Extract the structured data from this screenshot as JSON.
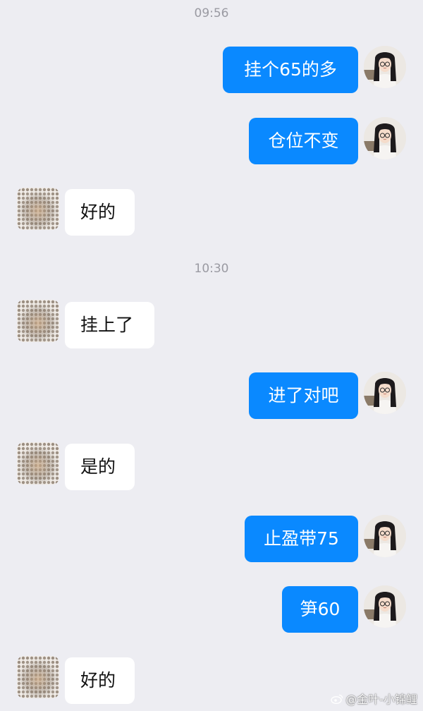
{
  "colors": {
    "background": "#ededf2",
    "outgoing_bubble": "#0a89ff",
    "incoming_bubble": "#ffffff",
    "timestamp": "#9a9aa2"
  },
  "timestamps": [
    "09:56",
    "10:30"
  ],
  "messages": [
    {
      "sender": "me",
      "text": "挂个65的多",
      "avatar_icon": "avatar-girl-glasses-icon"
    },
    {
      "sender": "me",
      "text": "仓位不变",
      "avatar_icon": "avatar-girl-glasses-icon"
    },
    {
      "sender": "them",
      "text": "好的",
      "avatar_icon": "avatar-blurred-icon"
    },
    {
      "sender": "them",
      "text": "挂上了",
      "avatar_icon": "avatar-blurred-icon"
    },
    {
      "sender": "me",
      "text": "进了对吧",
      "avatar_icon": "avatar-girl-glasses-icon"
    },
    {
      "sender": "them",
      "text": "是的",
      "avatar_icon": "avatar-blurred-icon"
    },
    {
      "sender": "me",
      "text": "止盈带75",
      "avatar_icon": "avatar-girl-glasses-icon"
    },
    {
      "sender": "me",
      "text": "笋60",
      "avatar_icon": "avatar-girl-glasses-icon"
    },
    {
      "sender": "them",
      "text": "好的",
      "avatar_icon": "avatar-blurred-icon"
    }
  ],
  "watermark": {
    "text": "@金叶-小锦鲤",
    "icon": "weibo-logo-icon"
  }
}
